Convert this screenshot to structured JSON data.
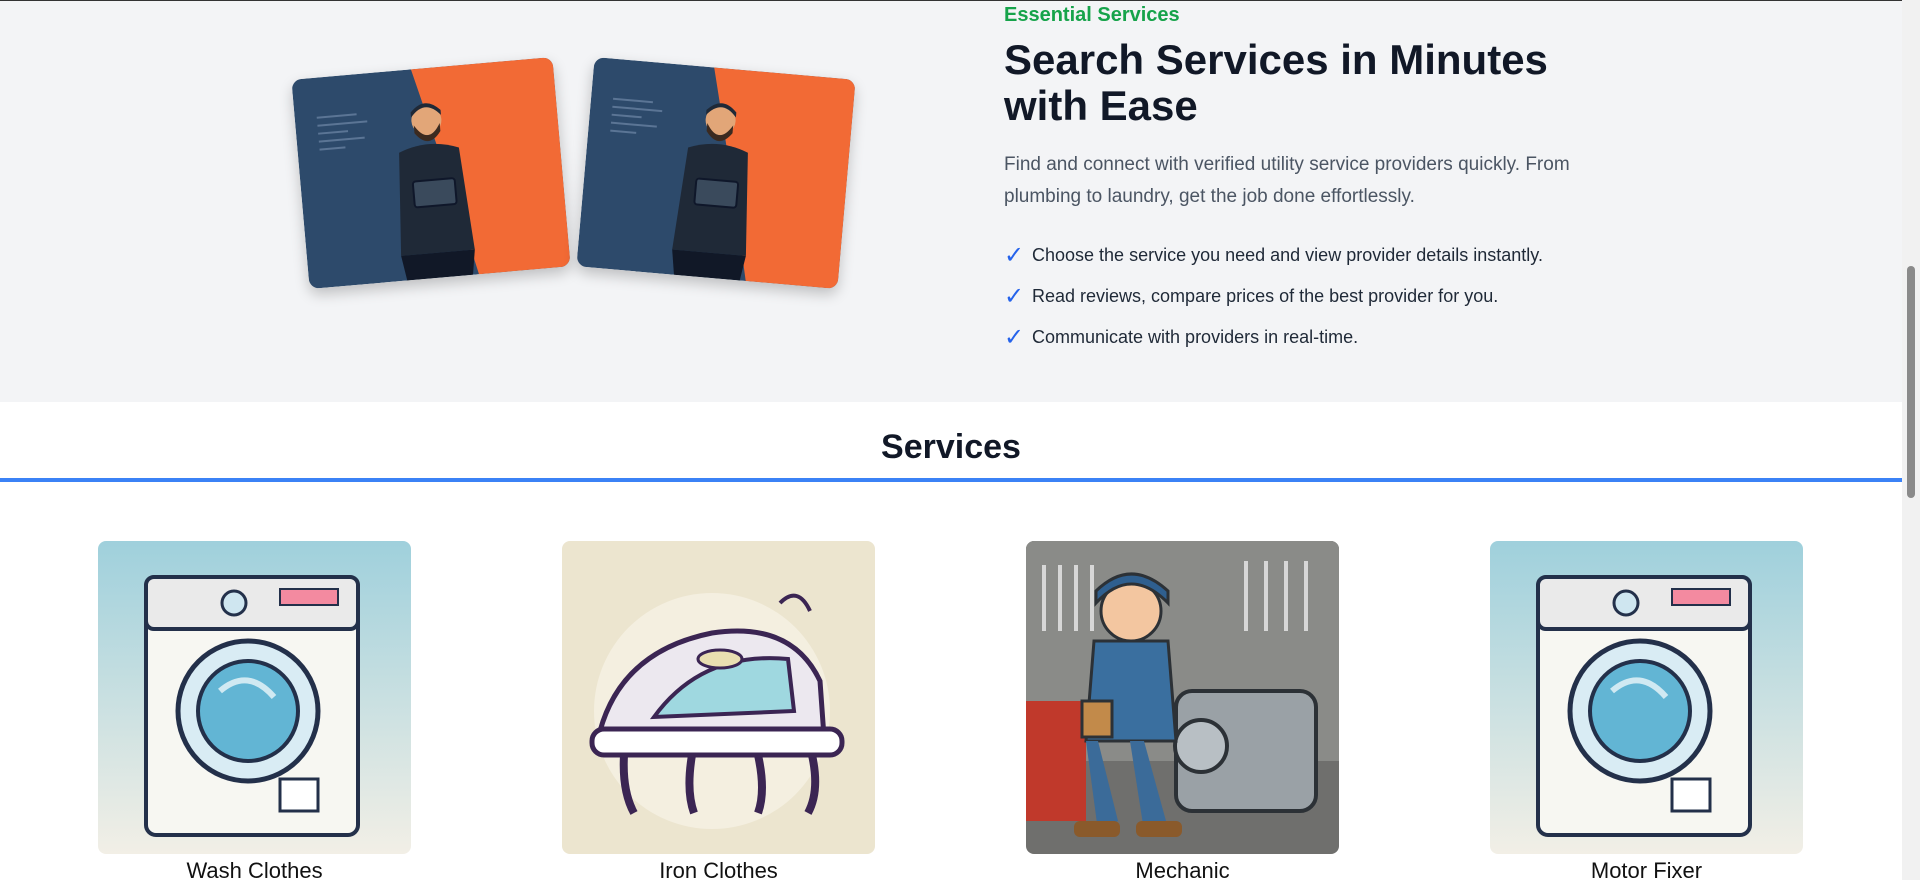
{
  "hero": {
    "eyebrow": "Essential Services",
    "headline": "Search Services in Minutes with Ease",
    "lead": "Find and connect with verified utility service providers quickly. From plumbing to laundry, get the job done effortlessly.",
    "check_glyph": "✓",
    "features": [
      "Choose the service you need and view provider details instantly.",
      "Read reviews, compare prices of the best provider for you.",
      "Communicate with providers in real-time."
    ]
  },
  "services": {
    "title": "Services",
    "items": [
      {
        "label": "Wash Clothes",
        "icon": "washing-machine"
      },
      {
        "label": "Iron Clothes",
        "icon": "iron"
      },
      {
        "label": "Mechanic",
        "icon": "mechanic"
      },
      {
        "label": "Motor Fixer",
        "icon": "washing-machine"
      }
    ]
  },
  "colors": {
    "accent_green": "#16a34a",
    "accent_blue": "#3b82f6",
    "card_navy": "#2d4a6b",
    "card_orange": "#f26a35"
  }
}
